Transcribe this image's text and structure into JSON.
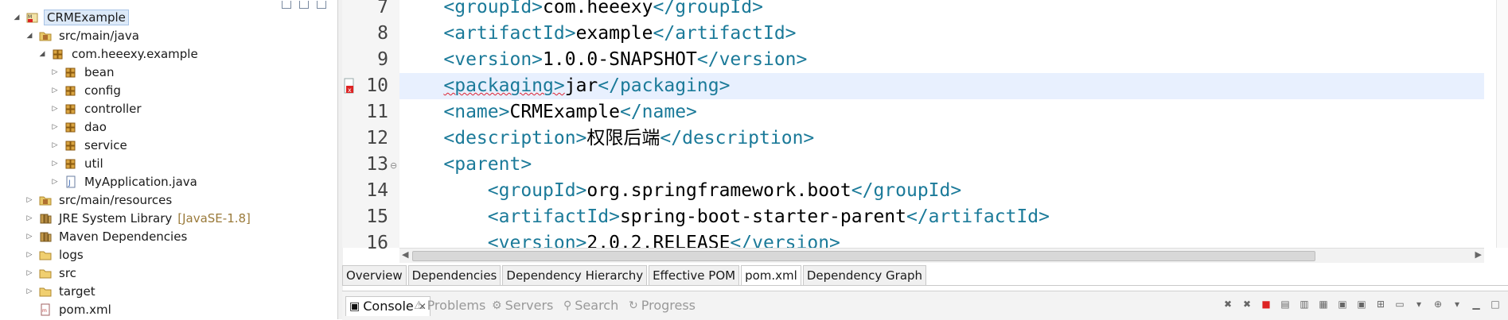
{
  "explorer": {
    "items": [
      {
        "label": "CRMExample",
        "depth": 0,
        "twisty": "open",
        "icon": "project-icon",
        "selected": true
      },
      {
        "label": "src/main/java",
        "depth": 1,
        "twisty": "open",
        "icon": "source-folder-icon"
      },
      {
        "label": "com.heeexy.example",
        "depth": 2,
        "twisty": "open",
        "icon": "package-icon"
      },
      {
        "label": "bean",
        "depth": 3,
        "twisty": "closed",
        "icon": "package-icon"
      },
      {
        "label": "config",
        "depth": 3,
        "twisty": "closed",
        "icon": "package-icon"
      },
      {
        "label": "controller",
        "depth": 3,
        "twisty": "closed",
        "icon": "package-icon"
      },
      {
        "label": "dao",
        "depth": 3,
        "twisty": "closed",
        "icon": "package-icon"
      },
      {
        "label": "service",
        "depth": 3,
        "twisty": "closed",
        "icon": "package-icon"
      },
      {
        "label": "util",
        "depth": 3,
        "twisty": "closed",
        "icon": "package-icon"
      },
      {
        "label": "MyApplication.java",
        "depth": 3,
        "twisty": "closed",
        "icon": "java-file-icon"
      },
      {
        "label": "src/main/resources",
        "depth": 1,
        "twisty": "closed",
        "icon": "source-folder-icon"
      },
      {
        "label": "JRE System Library",
        "decoration": "[JavaSE-1.8]",
        "depth": 1,
        "twisty": "closed",
        "icon": "library-icon"
      },
      {
        "label": "Maven Dependencies",
        "depth": 1,
        "twisty": "closed",
        "icon": "library-icon"
      },
      {
        "label": "logs",
        "depth": 1,
        "twisty": "closed",
        "icon": "folder-icon"
      },
      {
        "label": "src",
        "depth": 1,
        "twisty": "closed",
        "icon": "folder-icon"
      },
      {
        "label": "target",
        "depth": 1,
        "twisty": "closed",
        "icon": "folder-icon"
      },
      {
        "label": "pom.xml",
        "depth": 1,
        "twisty": "none",
        "icon": "xml-file-icon"
      }
    ]
  },
  "editor": {
    "lines": [
      {
        "num": "7",
        "indent": 1,
        "open": "<groupId>",
        "text": "com.heeexy",
        "close": "</groupId>"
      },
      {
        "num": "8",
        "indent": 1,
        "open": "<artifactId>",
        "text": "example",
        "close": "</artifactId>"
      },
      {
        "num": "9",
        "indent": 1,
        "open": "<version>",
        "text": "1.0.0-SNAPSHOT",
        "close": "</version>"
      },
      {
        "num": "10",
        "indent": 1,
        "open": "<packaging>",
        "text": "jar",
        "close": "</packaging>",
        "current": true,
        "error": true
      },
      {
        "num": "11",
        "indent": 1,
        "open": "<name>",
        "text": "CRMExample",
        "close": "</name>"
      },
      {
        "num": "12",
        "indent": 1,
        "open": "<description>",
        "text": "权限后端",
        "close": "</description>"
      },
      {
        "num": "13",
        "indent": 1,
        "open": "<parent>",
        "text": "",
        "close": "",
        "fold": true
      },
      {
        "num": "14",
        "indent": 2,
        "open": "<groupId>",
        "text": "org.springframework.boot",
        "close": "</groupId>"
      },
      {
        "num": "15",
        "indent": 2,
        "open": "<artifactId>",
        "text": "spring-boot-starter-parent",
        "close": "</artifactId>"
      },
      {
        "num": "16",
        "indent": 2,
        "open": "<version>",
        "text": "2.0.2.RELEASE",
        "close": "</version>"
      }
    ]
  },
  "pom_tabs": [
    {
      "label": "Overview"
    },
    {
      "label": "Dependencies"
    },
    {
      "label": "Dependency Hierarchy"
    },
    {
      "label": "Effective POM"
    },
    {
      "label": "pom.xml",
      "active": true
    },
    {
      "label": "Dependency Graph"
    }
  ],
  "views": [
    {
      "label": "Console",
      "icon": "console-icon",
      "active": true
    },
    {
      "label": "Problems",
      "icon": "problems-icon"
    },
    {
      "label": "Servers",
      "icon": "servers-icon"
    },
    {
      "label": "Search",
      "icon": "search-icon"
    },
    {
      "label": "Progress",
      "icon": "progress-icon"
    }
  ],
  "colors": {
    "tag": "#1b7a99",
    "selection": "#dce9f8",
    "current_line": "#e8f0fe",
    "error": "#d22"
  }
}
